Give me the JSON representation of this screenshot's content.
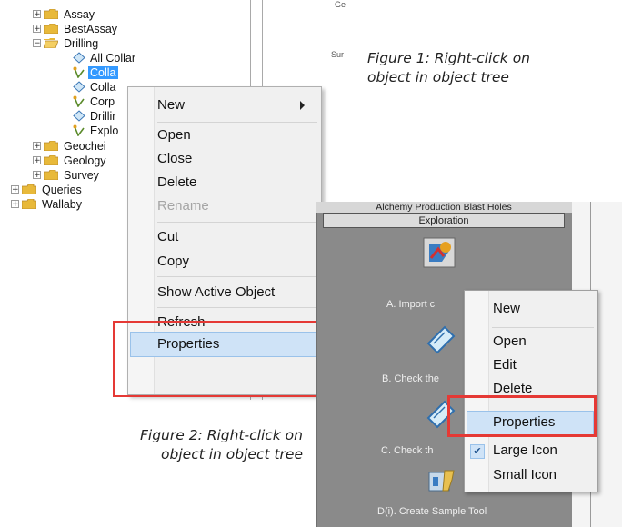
{
  "figure1": {
    "tree": {
      "items": [
        {
          "label": "Assay",
          "kind": "folder",
          "expander": "+"
        },
        {
          "label": "BestAssay",
          "kind": "folder",
          "expander": "+"
        },
        {
          "label": "Drilling",
          "kind": "folder-open",
          "expander": "−"
        },
        {
          "label": "All Collar",
          "kind": "object"
        },
        {
          "label": "Colla",
          "kind": "object",
          "selected": true
        },
        {
          "label": "Colla",
          "kind": "object"
        },
        {
          "label": "Corp",
          "kind": "object"
        },
        {
          "label": "Drillir",
          "kind": "object"
        },
        {
          "label": "Explo",
          "kind": "object"
        },
        {
          "label": "Geochei",
          "kind": "folder",
          "expander": "+"
        },
        {
          "label": "Geology",
          "kind": "folder",
          "expander": "+"
        },
        {
          "label": "Survey",
          "kind": "folder",
          "expander": "+"
        },
        {
          "label": "Queries",
          "kind": "folder",
          "expander": "+"
        },
        {
          "label": "Wallaby",
          "kind": "folder",
          "expander": "+"
        }
      ]
    },
    "side_label_1": "Ge",
    "side_label_2": "Sur",
    "context_menu": {
      "new": "New",
      "open": "Open",
      "close": "Close",
      "delete": "Delete",
      "rename": "Rename",
      "cut": "Cut",
      "copy": "Copy",
      "show_active": "Show Active Object",
      "refresh": "Refresh",
      "properties": "Properties"
    },
    "caption_line1": "Figure 1: Right-click on",
    "caption_line2": "object in object tree"
  },
  "figure2": {
    "header_title": "Alchemy Production Blast Holes",
    "panel_title": "Exploration",
    "tools": [
      {
        "label": "A. Import c"
      },
      {
        "label": "B. Check the"
      },
      {
        "label": "C. Check th"
      },
      {
        "label": "D(i). Create Sample Tool"
      }
    ],
    "context_menu": {
      "new": "New",
      "open": "Open",
      "edit": "Edit",
      "delete": "Delete",
      "properties": "Properties",
      "large_icon": "Large Icon",
      "small_icon": "Small Icon"
    },
    "caption_line1": "Figure 2: Right-click on",
    "caption_line2": "object in object tree"
  },
  "colors": {
    "highlight_box": "#e53935",
    "menu_highlight": "#cfe3f7",
    "tree_selection": "#3399ff"
  }
}
